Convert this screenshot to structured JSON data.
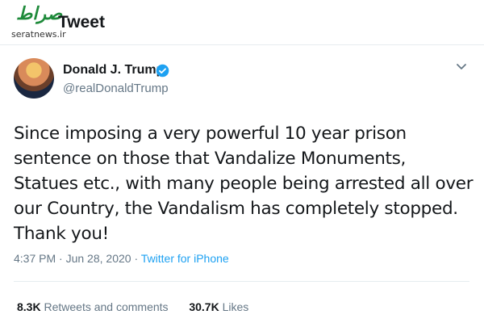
{
  "watermark": {
    "logo_text": "صراط",
    "site": "seratnews.ir"
  },
  "header": {
    "title": "Tweet"
  },
  "tweet": {
    "author_name": "Donald J. Trump",
    "author_handle": "@realDonaldTrump",
    "text": "Since imposing a very powerful 10 year prison sentence on those that Vandalize Monuments, Statues etc., with many people being arrested all over our Country, the Vandalism has completely stopped. Thank you!",
    "time": "4:37 PM",
    "date": "Jun 28, 2020",
    "separator": " · ",
    "source": "Twitter for iPhone"
  },
  "stats": {
    "retweets_count": "8.3K",
    "retweets_label": "Retweets and comments",
    "likes_count": "30.7K",
    "likes_label": "Likes"
  },
  "icons": {
    "verified": "verified-badge-icon",
    "menu": "chevron-down-icon"
  },
  "colors": {
    "accent": "#1da1f2",
    "secondary_text": "#657786",
    "primary_text": "#14171a"
  }
}
